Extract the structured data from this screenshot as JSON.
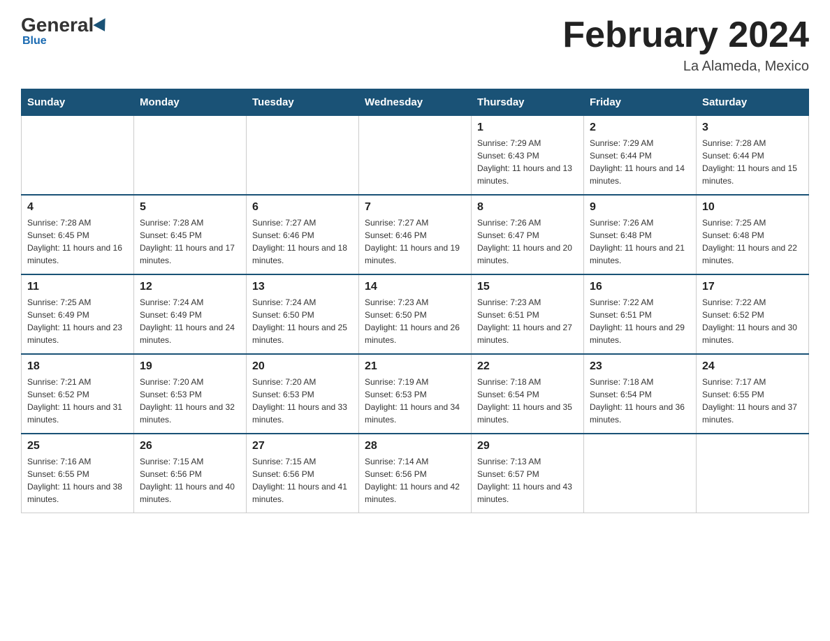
{
  "header": {
    "logo_general": "General",
    "logo_blue": "Blue",
    "month_title": "February 2024",
    "location": "La Alameda, Mexico"
  },
  "days_of_week": [
    "Sunday",
    "Monday",
    "Tuesday",
    "Wednesday",
    "Thursday",
    "Friday",
    "Saturday"
  ],
  "weeks": [
    {
      "days": [
        {
          "number": "",
          "info": ""
        },
        {
          "number": "",
          "info": ""
        },
        {
          "number": "",
          "info": ""
        },
        {
          "number": "",
          "info": ""
        },
        {
          "number": "1",
          "info": "Sunrise: 7:29 AM\nSunset: 6:43 PM\nDaylight: 11 hours and 13 minutes."
        },
        {
          "number": "2",
          "info": "Sunrise: 7:29 AM\nSunset: 6:44 PM\nDaylight: 11 hours and 14 minutes."
        },
        {
          "number": "3",
          "info": "Sunrise: 7:28 AM\nSunset: 6:44 PM\nDaylight: 11 hours and 15 minutes."
        }
      ]
    },
    {
      "days": [
        {
          "number": "4",
          "info": "Sunrise: 7:28 AM\nSunset: 6:45 PM\nDaylight: 11 hours and 16 minutes."
        },
        {
          "number": "5",
          "info": "Sunrise: 7:28 AM\nSunset: 6:45 PM\nDaylight: 11 hours and 17 minutes."
        },
        {
          "number": "6",
          "info": "Sunrise: 7:27 AM\nSunset: 6:46 PM\nDaylight: 11 hours and 18 minutes."
        },
        {
          "number": "7",
          "info": "Sunrise: 7:27 AM\nSunset: 6:46 PM\nDaylight: 11 hours and 19 minutes."
        },
        {
          "number": "8",
          "info": "Sunrise: 7:26 AM\nSunset: 6:47 PM\nDaylight: 11 hours and 20 minutes."
        },
        {
          "number": "9",
          "info": "Sunrise: 7:26 AM\nSunset: 6:48 PM\nDaylight: 11 hours and 21 minutes."
        },
        {
          "number": "10",
          "info": "Sunrise: 7:25 AM\nSunset: 6:48 PM\nDaylight: 11 hours and 22 minutes."
        }
      ]
    },
    {
      "days": [
        {
          "number": "11",
          "info": "Sunrise: 7:25 AM\nSunset: 6:49 PM\nDaylight: 11 hours and 23 minutes."
        },
        {
          "number": "12",
          "info": "Sunrise: 7:24 AM\nSunset: 6:49 PM\nDaylight: 11 hours and 24 minutes."
        },
        {
          "number": "13",
          "info": "Sunrise: 7:24 AM\nSunset: 6:50 PM\nDaylight: 11 hours and 25 minutes."
        },
        {
          "number": "14",
          "info": "Sunrise: 7:23 AM\nSunset: 6:50 PM\nDaylight: 11 hours and 26 minutes."
        },
        {
          "number": "15",
          "info": "Sunrise: 7:23 AM\nSunset: 6:51 PM\nDaylight: 11 hours and 27 minutes."
        },
        {
          "number": "16",
          "info": "Sunrise: 7:22 AM\nSunset: 6:51 PM\nDaylight: 11 hours and 29 minutes."
        },
        {
          "number": "17",
          "info": "Sunrise: 7:22 AM\nSunset: 6:52 PM\nDaylight: 11 hours and 30 minutes."
        }
      ]
    },
    {
      "days": [
        {
          "number": "18",
          "info": "Sunrise: 7:21 AM\nSunset: 6:52 PM\nDaylight: 11 hours and 31 minutes."
        },
        {
          "number": "19",
          "info": "Sunrise: 7:20 AM\nSunset: 6:53 PM\nDaylight: 11 hours and 32 minutes."
        },
        {
          "number": "20",
          "info": "Sunrise: 7:20 AM\nSunset: 6:53 PM\nDaylight: 11 hours and 33 minutes."
        },
        {
          "number": "21",
          "info": "Sunrise: 7:19 AM\nSunset: 6:53 PM\nDaylight: 11 hours and 34 minutes."
        },
        {
          "number": "22",
          "info": "Sunrise: 7:18 AM\nSunset: 6:54 PM\nDaylight: 11 hours and 35 minutes."
        },
        {
          "number": "23",
          "info": "Sunrise: 7:18 AM\nSunset: 6:54 PM\nDaylight: 11 hours and 36 minutes."
        },
        {
          "number": "24",
          "info": "Sunrise: 7:17 AM\nSunset: 6:55 PM\nDaylight: 11 hours and 37 minutes."
        }
      ]
    },
    {
      "days": [
        {
          "number": "25",
          "info": "Sunrise: 7:16 AM\nSunset: 6:55 PM\nDaylight: 11 hours and 38 minutes."
        },
        {
          "number": "26",
          "info": "Sunrise: 7:15 AM\nSunset: 6:56 PM\nDaylight: 11 hours and 40 minutes."
        },
        {
          "number": "27",
          "info": "Sunrise: 7:15 AM\nSunset: 6:56 PM\nDaylight: 11 hours and 41 minutes."
        },
        {
          "number": "28",
          "info": "Sunrise: 7:14 AM\nSunset: 6:56 PM\nDaylight: 11 hours and 42 minutes."
        },
        {
          "number": "29",
          "info": "Sunrise: 7:13 AM\nSunset: 6:57 PM\nDaylight: 11 hours and 43 minutes."
        },
        {
          "number": "",
          "info": ""
        },
        {
          "number": "",
          "info": ""
        }
      ]
    }
  ]
}
